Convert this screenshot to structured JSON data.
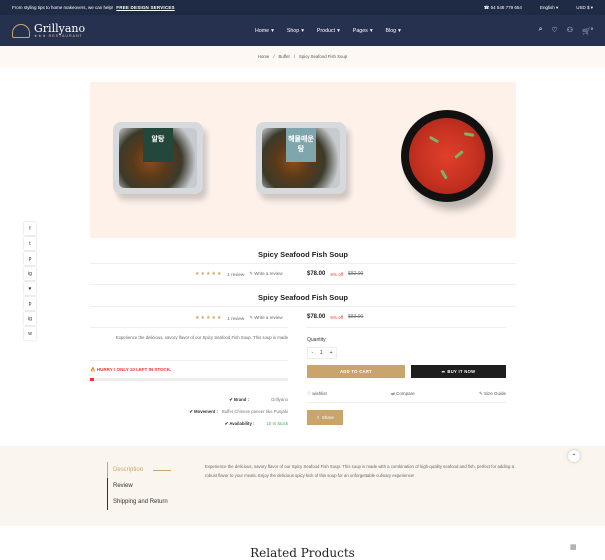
{
  "topbar": {
    "promo": "From styling tips to home makeovers, we can help!",
    "promo_link": "FREE DESIGN SERVICES",
    "phone": "54 548 779 654",
    "language": "English",
    "currency": "USD $"
  },
  "header": {
    "logo_name": "Grillyano",
    "logo_sub": "RESTAURANT",
    "nav": [
      "Home",
      "Shop",
      "Product",
      "Pages",
      "Blog"
    ],
    "cart_count": "0"
  },
  "breadcrumb": [
    "Home",
    "Buffet",
    "Spicy Seafood Fish Soup"
  ],
  "gallery": {
    "pack1_label": "알탕",
    "pack2_label": "해물매운탕"
  },
  "social": [
    "f",
    "t",
    "p",
    "ig",
    "♥",
    "p",
    "ig",
    "w"
  ],
  "product": {
    "title": "Spicy Seafood Fish Soup",
    "review_link": "1 review",
    "write_review": "Write a review",
    "price": "$78.00",
    "discount": "5% off",
    "old_price": "$82.00",
    "description": "Experience the delicious, savory flavor of our Spicy Seafood Fish Soup. This soup is made",
    "hurry": "HURRY ! ONLY 10 LEFT IN STOCK.",
    "stock_fraction": 0.02,
    "brand_label": "Brand :",
    "brand": "Grillyano",
    "movement_label": "Movement :",
    "movement": "Buffet Chinese paneer tike Punjabi",
    "availability_label": "Availability :",
    "availability": "10 In Stock",
    "quantity_label": "Quantity",
    "quantity": "1",
    "add_to_cart": "ADD TO CART",
    "buy_now": "BUY IT NOW",
    "wishlist": "wishlist",
    "compare": "Compare",
    "size_guide": "Size Guide",
    "share": "Share"
  },
  "tabs": {
    "items": [
      "Description",
      "Review",
      "Shipping and Return"
    ],
    "description_text": "Experience the delicious, savory flavor of our Spicy Seafood Fish Soup. This soup is made with a combination of high-quality seafood and fish, perfect for adding a robust flavor to your meals. Enjoy the delicious spicy kick of this soup for an unforgettable culinary experience!"
  },
  "related_title": "Related Products",
  "colors": {
    "navy": "#263150",
    "gold": "#c9a56b",
    "red": "#e33333",
    "dark_btn": "#1e1e1e"
  }
}
